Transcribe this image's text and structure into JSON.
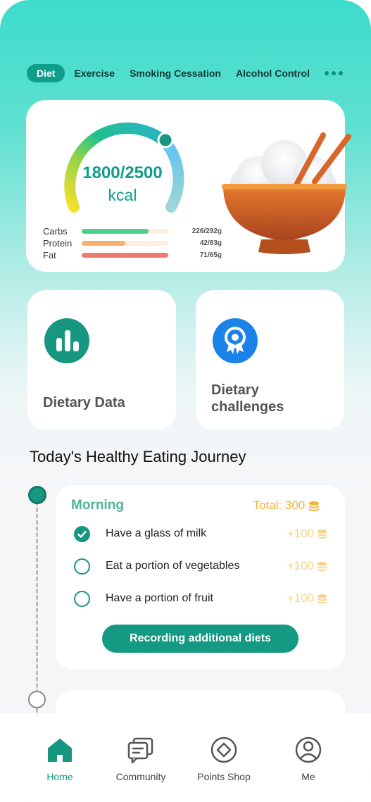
{
  "tabs": {
    "items": [
      {
        "label": "Diet",
        "active": true
      },
      {
        "label": "Exercise",
        "active": false
      },
      {
        "label": "Smoking Cessation",
        "active": false
      },
      {
        "label": "Alcohol Control",
        "active": false
      }
    ],
    "more_icon": "more-dots-icon"
  },
  "calorie": {
    "value": "1800/2500",
    "unit": "kcal",
    "consumed": 1800,
    "goal": 2500,
    "macros": [
      {
        "name": "Carbs",
        "value": "226/292g",
        "current": 226,
        "target": 292,
        "color": "#4fcf8e"
      },
      {
        "name": "Protein",
        "value": "42/83g",
        "current": 42,
        "target": 83,
        "color": "#f6b26b"
      },
      {
        "name": "Fat",
        "value": "71/65g",
        "current": 71,
        "target": 65,
        "color": "#ef7b6d"
      }
    ]
  },
  "features": [
    {
      "label_line1": "Dietary Data",
      "label_line2": "",
      "icon": "bar-chart-icon",
      "color": "#17977f"
    },
    {
      "label_line1": "Dietary",
      "label_line2": "challenges",
      "icon": "award-ribbon-icon",
      "color": "#1a82e8"
    }
  ],
  "journey": {
    "title": "Today's Healthy Eating Journey",
    "period": "Morning",
    "total": "Total: 300",
    "tasks": [
      {
        "label": "Have a glass of milk",
        "points": "+100",
        "done": true
      },
      {
        "label": "Eat a portion of vegetables",
        "points": "+100",
        "done": false
      },
      {
        "label": "Have a portion of fruit",
        "points": "+100",
        "done": false
      }
    ],
    "record_button": "Recording additional diets"
  },
  "nav": [
    {
      "label": "Home",
      "icon": "home-icon",
      "active": true
    },
    {
      "label": "Community",
      "icon": "community-icon",
      "active": false
    },
    {
      "label": "Points Shop",
      "icon": "points-shop-icon",
      "active": false
    },
    {
      "label": "Me",
      "icon": "profile-icon",
      "active": false
    }
  ],
  "colors": {
    "accent": "#17977f",
    "gold": "#f2b432",
    "blue": "#1a82e8"
  }
}
